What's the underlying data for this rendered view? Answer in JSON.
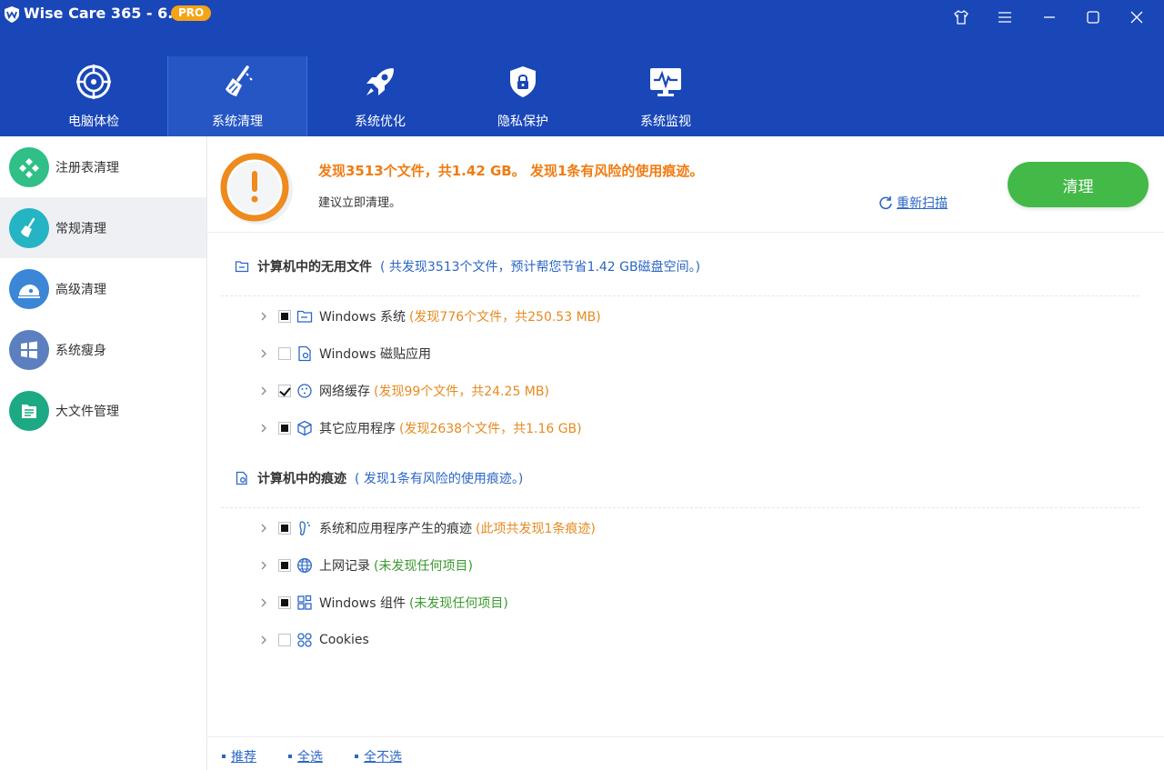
{
  "window": {
    "title": "Wise Care 365 - 6.5.3",
    "badge": "PRO"
  },
  "tabs": [
    {
      "label": "电脑体检",
      "icon": "radar-icon"
    },
    {
      "label": "系统清理",
      "icon": "broom-icon",
      "active": true
    },
    {
      "label": "系统优化",
      "icon": "rocket-icon"
    },
    {
      "label": "隐私保护",
      "icon": "shield-lock-icon"
    },
    {
      "label": "系统监视",
      "icon": "monitor-icon"
    }
  ],
  "sidebar": {
    "items": [
      {
        "label": "注册表清理",
        "icon": "registry-icon"
      },
      {
        "label": "常规清理",
        "icon": "broom-icon",
        "active": true
      },
      {
        "label": "高级清理",
        "icon": "disk-clean-icon"
      },
      {
        "label": "系统瘦身",
        "icon": "windows-icon"
      },
      {
        "label": "大文件管理",
        "icon": "file-list-icon"
      }
    ]
  },
  "alert": {
    "title": "发现3513个文件，共1.42 GB。 发现1条有风险的使用痕迹。",
    "subtitle": "建议立即清理。",
    "rescan": "重新扫描",
    "clean_button": "清理"
  },
  "sections": [
    {
      "title": "计算机中的无用文件",
      "desc": "( 共发现3513个文件，预计帮您节省1.42 GB磁盘空间。)",
      "items": [
        {
          "label": "Windows 系统",
          "info": "(发现776个文件，共250.53 MB)",
          "state": "partial"
        },
        {
          "label": "Windows 磁贴应用",
          "info": "",
          "state": "unchecked"
        },
        {
          "label": "网络缓存",
          "info": "(发现99个文件，共24.25 MB)",
          "state": "checked"
        },
        {
          "label": "其它应用程序",
          "info": "(发现2638个文件，共1.16 GB)",
          "state": "partial"
        }
      ]
    },
    {
      "title": "计算机中的痕迹",
      "desc": "( 发现1条有风险的使用痕迹。)",
      "items": [
        {
          "label": "系统和应用程序产生的痕迹",
          "info": "(此项共发现1条痕迹)",
          "state": "partial"
        },
        {
          "label": "上网记录",
          "info": "(未发现任何项目)",
          "state": "partial"
        },
        {
          "label": "Windows 组件",
          "info": "(未发现任何项目)",
          "state": "partial"
        },
        {
          "label": "Cookies",
          "info": "",
          "state": "unchecked"
        }
      ]
    }
  ],
  "footer": {
    "recommend": "推荐",
    "select_all": "全选",
    "select_none": "全不选"
  },
  "colors": {
    "header_blue": "#1a47b7",
    "accent_orange": "#f07c14",
    "clean_green": "#43b947",
    "link_blue": "#2b66c5"
  }
}
